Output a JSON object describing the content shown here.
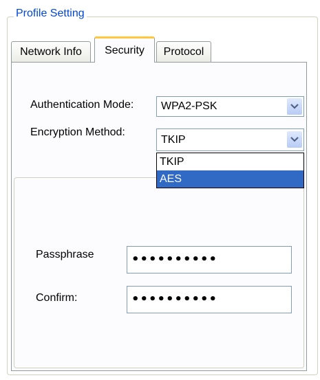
{
  "group": {
    "title": "Profile Setting"
  },
  "tabs": [
    {
      "label": "Network Info"
    },
    {
      "label": "Security"
    },
    {
      "label": "Protocol"
    }
  ],
  "security": {
    "auth_label": "Authentication Mode:",
    "auth_value": "WPA2-PSK",
    "enc_label": "Encryption Method:",
    "enc_value": "TKIP",
    "enc_options": [
      "TKIP",
      "AES"
    ],
    "enc_highlighted": "AES",
    "passphrase_label": "Passphrase",
    "passphrase_value": "••••••••••",
    "confirm_label": "Confirm:",
    "confirm_value": "••••••••••"
  },
  "icons": {
    "dropdown_arrow": "chevron-down-icon"
  },
  "colors": {
    "title": "#0046d5",
    "tab_accent": "#ffc83c",
    "selection": "#316ac5"
  }
}
